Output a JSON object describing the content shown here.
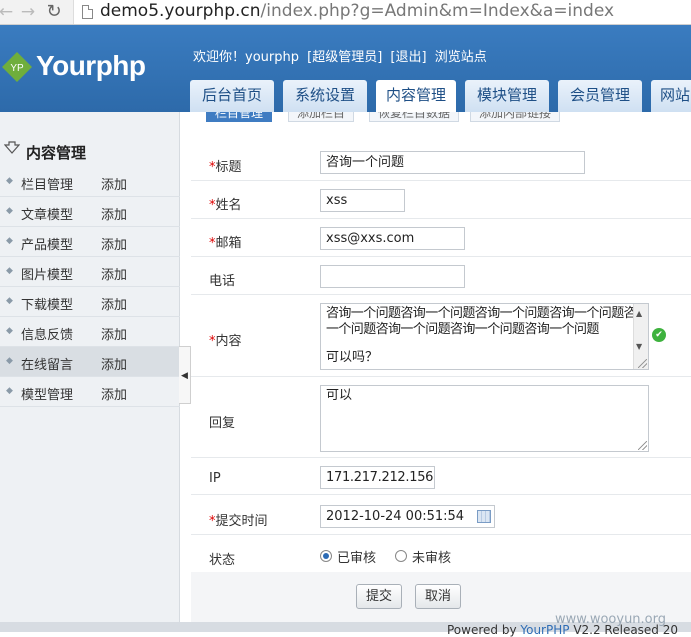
{
  "browser": {
    "url_host": "demo5.yourphp.cn",
    "url_path": "/index.php?g=Admin&m=Index&a=index"
  },
  "header": {
    "logo_text": "Yourphp",
    "logo_badge": "YP",
    "user_bar": {
      "welcome": "欢迎你！yourphp",
      "role": "[超级管理员]",
      "logout": "[退出]",
      "browse": "浏览站点"
    },
    "tabs": [
      {
        "label": "后台首页",
        "active": false
      },
      {
        "label": "系统设置",
        "active": false
      },
      {
        "label": "内容管理",
        "active": true
      },
      {
        "label": "模块管理",
        "active": false
      },
      {
        "label": "会员管理",
        "active": false
      },
      {
        "label": "网站",
        "active": false
      }
    ]
  },
  "sidebar": {
    "title": "内容管理",
    "items": [
      {
        "label": "栏目管理",
        "action": "添加"
      },
      {
        "label": "文章模型",
        "action": "添加"
      },
      {
        "label": "产品模型",
        "action": "添加"
      },
      {
        "label": "图片模型",
        "action": "添加"
      },
      {
        "label": "下载模型",
        "action": "添加"
      },
      {
        "label": "信息反馈",
        "action": "添加"
      },
      {
        "label": "在线留言",
        "action": "添加",
        "active": true
      },
      {
        "label": "模型管理",
        "action": "添加"
      }
    ]
  },
  "sub_tabs": [
    "栏目管理",
    "添加栏目",
    "恢复栏目数据",
    "添加内部链接"
  ],
  "form": {
    "title": {
      "label": "标题",
      "required": true,
      "value": "咨询一个问题"
    },
    "name": {
      "label": "姓名",
      "required": true,
      "value": "xss"
    },
    "email": {
      "label": "邮箱",
      "required": true,
      "value": "xss@xxs.com"
    },
    "phone": {
      "label": "电话",
      "required": false,
      "value": ""
    },
    "content": {
      "label": "内容",
      "required": true,
      "line1": "咨询一个问题咨询一个问题咨询一个问题咨询一个问题咨询",
      "line2": "一个问题咨询一个问题咨询一个问题咨询一个问题",
      "line3": "可以吗？"
    },
    "reply": {
      "label": "回复",
      "required": false,
      "value": "可以"
    },
    "ip": {
      "label": "IP",
      "required": false,
      "value": "171.217.212.156"
    },
    "submit_time": {
      "label": "提交时间",
      "required": true,
      "value": "2012-10-24 00:51:54"
    },
    "status": {
      "label": "状态",
      "options": [
        {
          "label": "已审核",
          "checked": true
        },
        {
          "label": "未审核",
          "checked": false
        }
      ]
    },
    "required_mark": "*"
  },
  "buttons": {
    "submit": "提交",
    "cancel": "取消"
  },
  "footer": {
    "powered_prefix": "Powered by ",
    "powered_link": "YourPHP",
    "powered_suffix": " V2.2 Released 20",
    "watermark": "www.wooyun.org"
  },
  "colors": {
    "header_blue": "#2d6aaa",
    "required_red": "#dd0000",
    "success_green": "#3eb23e"
  }
}
